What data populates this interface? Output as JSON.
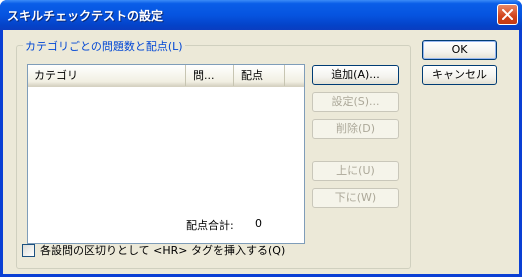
{
  "dialog": {
    "title": "スキルチェックテストの設定"
  },
  "group": {
    "legend": "カテゴリごとの問題数と配点(L)"
  },
  "listview": {
    "columns": [
      "カテゴリ",
      "問...",
      "配点",
      ""
    ],
    "rows": []
  },
  "total": {
    "label": "配点合計:",
    "value": "0"
  },
  "buttons": {
    "ok": "OK",
    "cancel": "キャンセル",
    "add": "追加(A)...",
    "settings": "設定(S)...",
    "delete": "削除(D)",
    "up": "上に(U)",
    "down": "下に(W)"
  },
  "checkbox": {
    "label": "各設問の区切りとして <HR> タグを挿入する(Q)",
    "checked": false
  }
}
